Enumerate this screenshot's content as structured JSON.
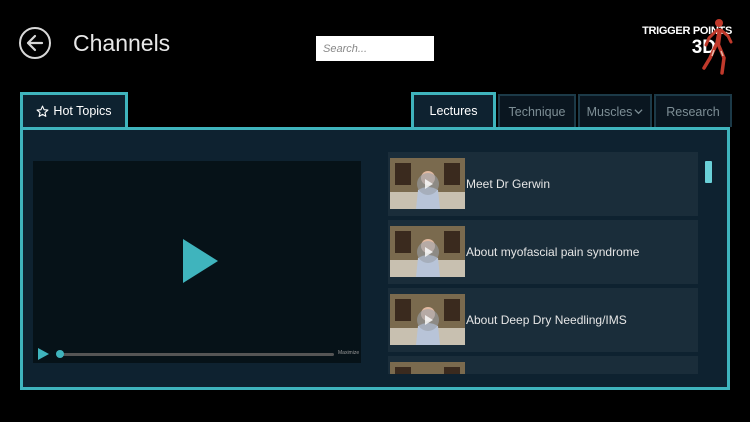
{
  "header": {
    "title": "Channels",
    "search_placeholder": "Search...",
    "logo_line1": "TRIGGER POINTS",
    "logo_line2": "3D"
  },
  "tabs": {
    "hot_topics": "Hot Topics",
    "lectures": "Lectures",
    "technique": "Technique",
    "muscles": "Muscles",
    "research": "Research"
  },
  "player": {
    "control_label": "Maximize"
  },
  "videos": [
    {
      "label": "Meet Dr Gerwin"
    },
    {
      "label": "About myofascial pain syndrome"
    },
    {
      "label": "About Deep Dry Needling/IMS"
    },
    {
      "label": ""
    }
  ],
  "colors": {
    "accent": "#3fb4bd",
    "panel_bg": "#0e2230",
    "background": "#000000"
  }
}
